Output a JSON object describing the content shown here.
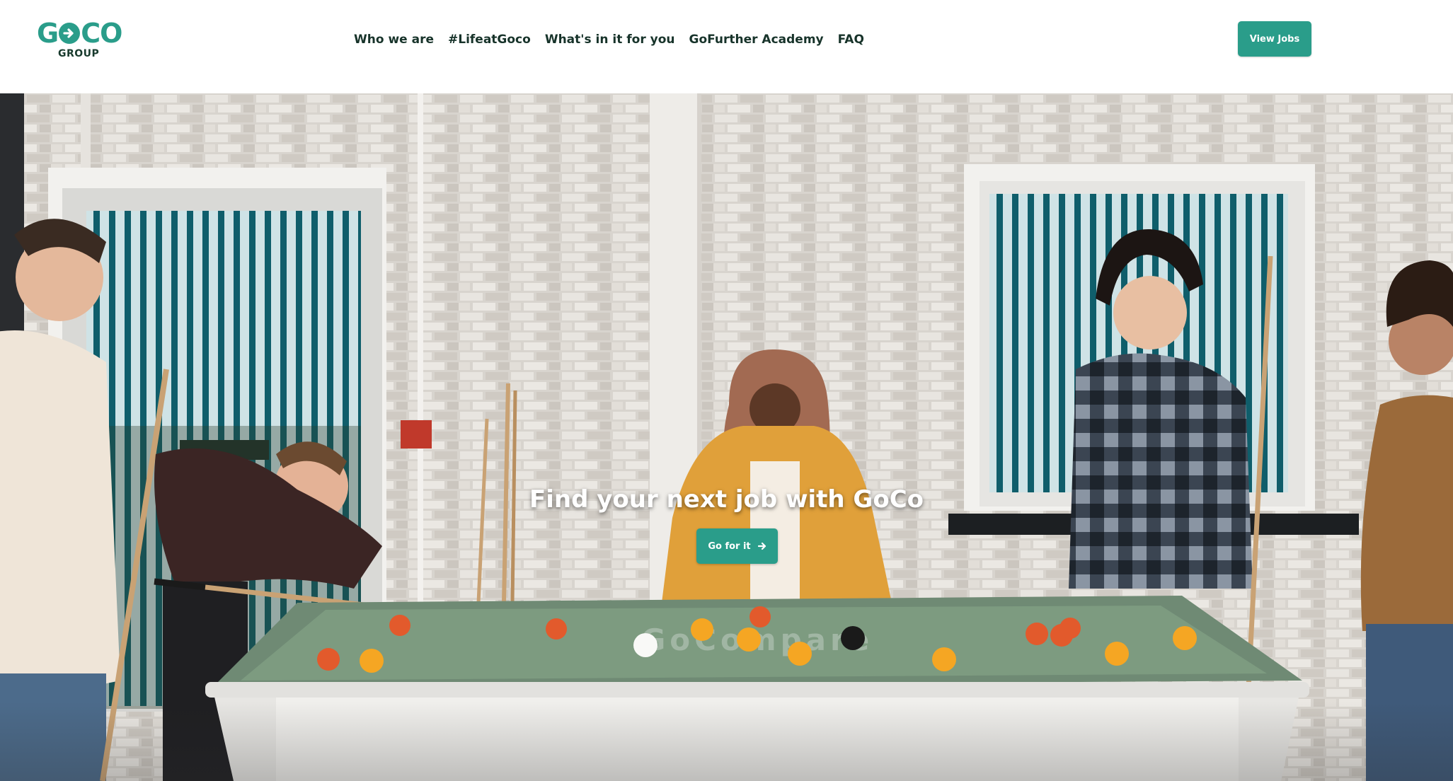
{
  "logo": {
    "main": "GoCo",
    "sub": "GROUP",
    "icon": "arrow-right-icon"
  },
  "nav": {
    "items": [
      {
        "label": "Who we are"
      },
      {
        "label": "#LifeatGoco"
      },
      {
        "label": "What's in it for you"
      },
      {
        "label": "GoFurther Academy"
      },
      {
        "label": "FAQ"
      }
    ]
  },
  "header": {
    "view_jobs_label": "View Jobs"
  },
  "hero": {
    "title": "Find your next job with GoCo",
    "cta_label": "Go for it",
    "cta_icon": "arrow-right-icon",
    "table_print": "GoCompare"
  },
  "colors": {
    "accent": "#2a9d8a",
    "nav_text": "#17332a"
  }
}
